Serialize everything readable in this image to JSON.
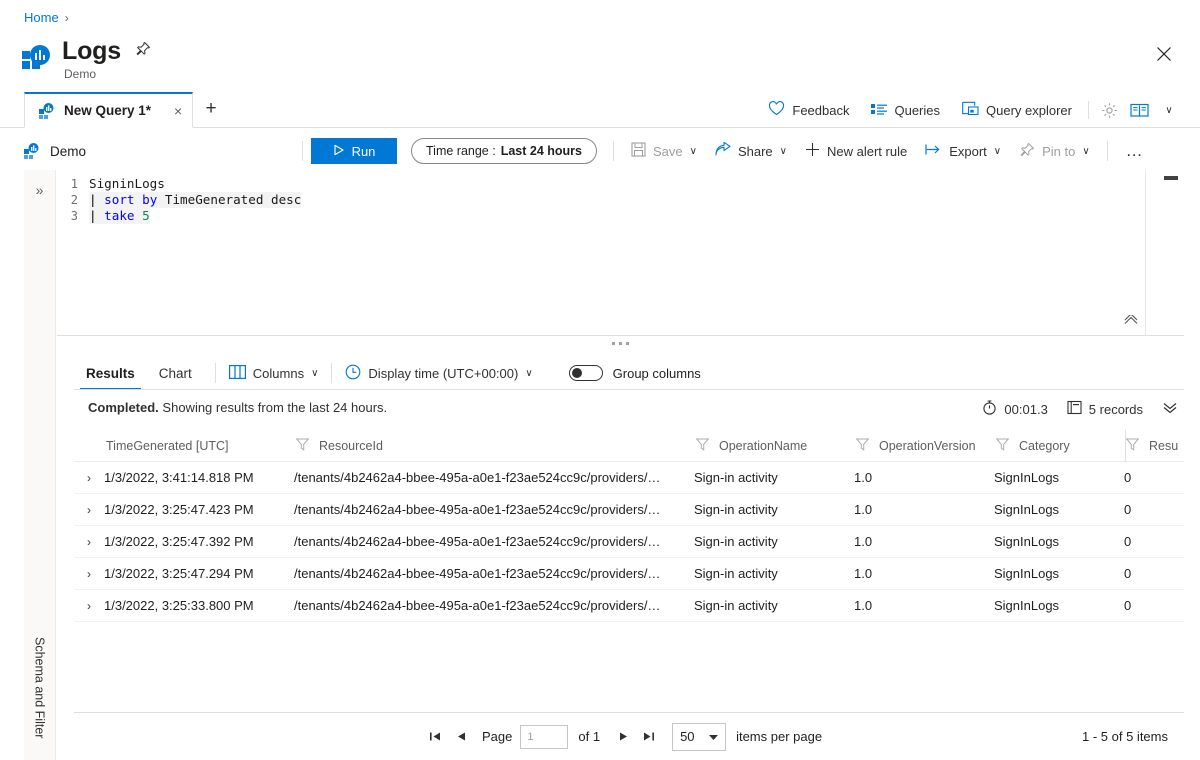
{
  "breadcrumb": {
    "home": "Home",
    "separator": "›"
  },
  "header": {
    "title": "Logs",
    "subtitle": "Demo",
    "pin_icon": "pin-icon",
    "more_icon": "ellipsis-icon",
    "close_icon": "close-icon"
  },
  "tabs": {
    "query_tab": {
      "label": "New Query 1*",
      "close": "×",
      "icon": "query-icon"
    },
    "add_label": "+"
  },
  "top_actions": {
    "feedback": "Feedback",
    "queries": "Queries",
    "query_explorer": "Query explorer",
    "settings_icon": "gear-icon",
    "guide_icon": "book-icon",
    "guide_chevron": "∨"
  },
  "command_bar": {
    "workspace": "Demo",
    "run": "Run",
    "run_icon": "play-icon",
    "time_range_label": "Time range :",
    "time_range_value": "Last 24 hours",
    "save": "Save",
    "share": "Share",
    "new_alert_rule": "New alert rule",
    "export": "Export",
    "pin_to": "Pin to",
    "more": "…",
    "chevron": "∨"
  },
  "rail": {
    "expand_icon": "»",
    "label": "Schema and Filter"
  },
  "editor": {
    "lines": [
      {
        "n": "1",
        "segments": [
          {
            "t": "SigninLogs",
            "c": "plain"
          }
        ]
      },
      {
        "n": "2",
        "segments": [
          {
            "t": "| ",
            "c": "pipe"
          },
          {
            "t": "sort",
            "c": "kw"
          },
          {
            "t": " ",
            "c": "plain"
          },
          {
            "t": "by",
            "c": "kw"
          },
          {
            "t": " TimeGenerated desc",
            "c": "plain"
          }
        ]
      },
      {
        "n": "3",
        "segments": [
          {
            "t": "| ",
            "c": "pipe"
          },
          {
            "t": "take",
            "c": "kw"
          },
          {
            "t": " ",
            "c": "plain"
          },
          {
            "t": "5",
            "c": "num"
          }
        ]
      }
    ],
    "collapse_icon": "chevron-up-icon"
  },
  "results_toolbar": {
    "tab_results": "Results",
    "tab_chart": "Chart",
    "columns": "Columns",
    "columns_icon": "columns-icon",
    "display_time": "Display time (UTC+00:00)",
    "clock_icon": "clock-icon",
    "group_columns": "Group columns",
    "chevron": "∨"
  },
  "status": {
    "state": "Completed.",
    "message": "Showing results from the last 24 hours.",
    "duration": "00:01.3",
    "duration_icon": "timer-icon",
    "records": "5 records",
    "records_icon": "records-icon",
    "expand_icon": "»"
  },
  "table": {
    "columns": [
      {
        "label": "TimeGenerated [UTC]",
        "filter": false
      },
      {
        "label": "ResourceId",
        "filter": true
      },
      {
        "label": "OperationName",
        "filter": true
      },
      {
        "label": "OperationVersion",
        "filter": true
      },
      {
        "label": "Category",
        "filter": true
      },
      {
        "label": "Resu",
        "filter": true
      }
    ],
    "rows": [
      {
        "expand": "›",
        "time": "1/3/2022, 3:41:14.818 PM",
        "resource": "/tenants/4b2462a4-bbee-495a-a0e1-f23ae524cc9c/providers/…",
        "operation": "Sign-in activity",
        "version": "1.0",
        "category": "SignInLogs",
        "result": "0"
      },
      {
        "expand": "›",
        "time": "1/3/2022, 3:25:47.423 PM",
        "resource": "/tenants/4b2462a4-bbee-495a-a0e1-f23ae524cc9c/providers/…",
        "operation": "Sign-in activity",
        "version": "1.0",
        "category": "SignInLogs",
        "result": "0"
      },
      {
        "expand": "›",
        "time": "1/3/2022, 3:25:47.392 PM",
        "resource": "/tenants/4b2462a4-bbee-495a-a0e1-f23ae524cc9c/providers/…",
        "operation": "Sign-in activity",
        "version": "1.0",
        "category": "SignInLogs",
        "result": "0"
      },
      {
        "expand": "›",
        "time": "1/3/2022, 3:25:47.294 PM",
        "resource": "/tenants/4b2462a4-bbee-495a-a0e1-f23ae524cc9c/providers/…",
        "operation": "Sign-in activity",
        "version": "1.0",
        "category": "SignInLogs",
        "result": "0"
      },
      {
        "expand": "›",
        "time": "1/3/2022, 3:25:33.800 PM",
        "resource": "/tenants/4b2462a4-bbee-495a-a0e1-f23ae524cc9c/providers/…",
        "operation": "Sign-in activity",
        "version": "1.0",
        "category": "SignInLogs",
        "result": "0"
      }
    ]
  },
  "footer": {
    "first_icon": "⏮",
    "prev_icon": "◀",
    "page_label": "Page",
    "page_value": "1",
    "of_label": "of 1",
    "next_icon": "▶",
    "last_icon": "⏭",
    "per_page_value": "50",
    "per_page_label": "items per page",
    "items_count": "1 - 5 of 5 items"
  },
  "colors": {
    "accent": "#0078d4",
    "text": "#201f1e",
    "muted": "#605e5c",
    "border": "#e1dfdd",
    "keyword": "#0000ff",
    "number": "#098658"
  }
}
